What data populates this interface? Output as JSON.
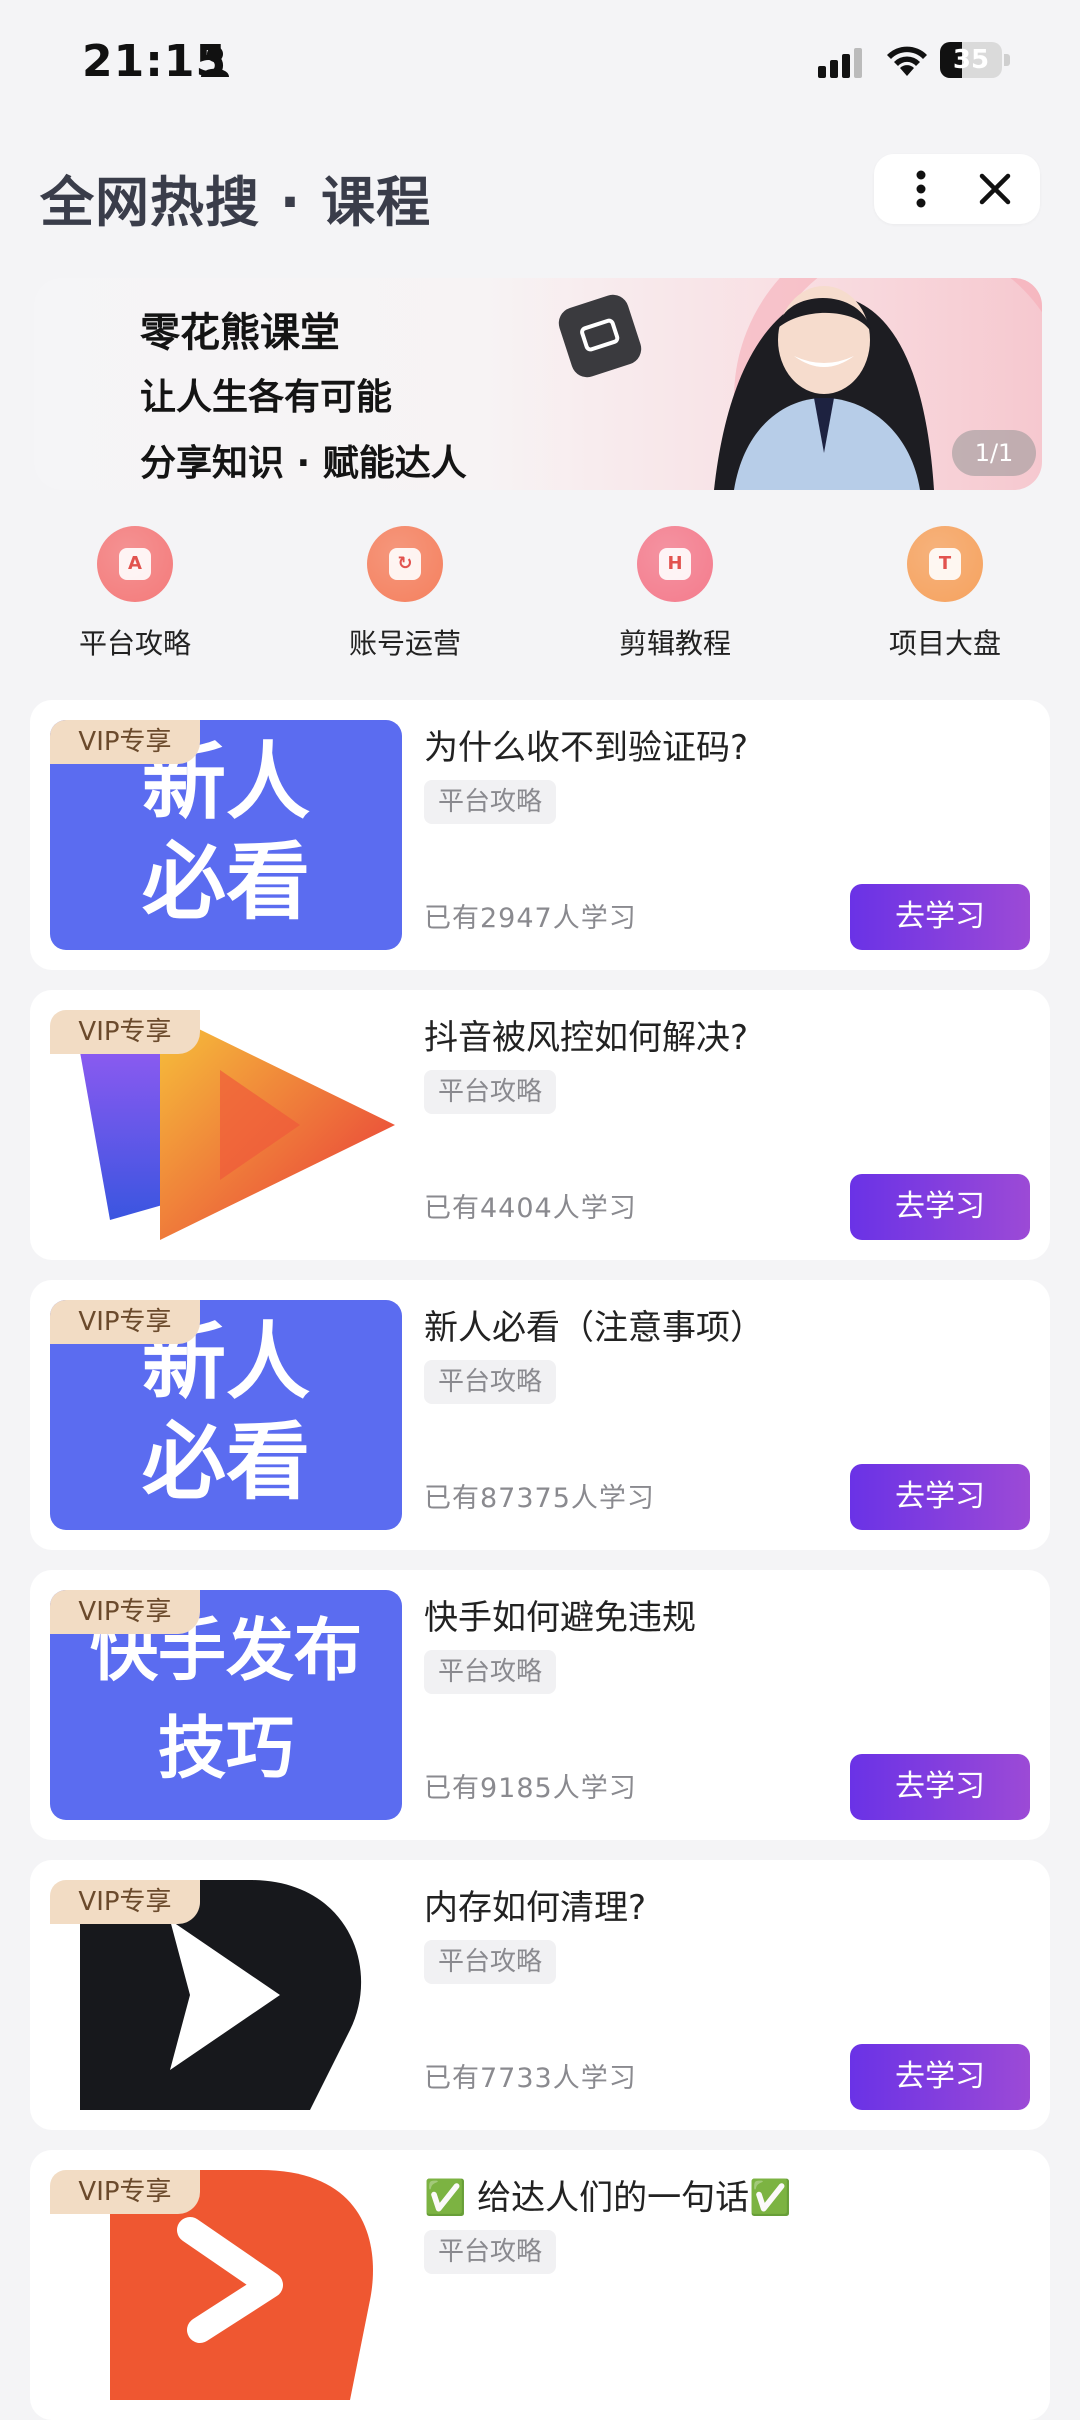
{
  "status_bar": {
    "time": "21:15",
    "battery": "35",
    "battery_level": 0.35
  },
  "header": {
    "title": "全网热搜 · 课程"
  },
  "banner": {
    "line1": "零花熊课堂",
    "line2": "让人生各有可能",
    "line3": "分享知识 · 赋能达人",
    "page_indicator": "1/1"
  },
  "categories": [
    {
      "label": "平台攻略",
      "icon": "A",
      "color": "#f47a7a"
    },
    {
      "label": "账号运营",
      "icon": "↻",
      "color": "#f5805e"
    },
    {
      "label": "剪辑教程",
      "icon": "H",
      "color": "#f47b8c"
    },
    {
      "label": "项目大盘",
      "icon": "T",
      "color": "#f6a25e"
    }
  ],
  "colors": {
    "accent_start": "#6a32e6",
    "accent_end": "#9c4ad6",
    "vip_badge": "#f2dcc4",
    "thumb_blue": "#5b6cf0"
  },
  "courses": [
    {
      "badge": "VIP专享",
      "title": "为什么收不到验证码?",
      "tag": "平台攻略",
      "stats": "已有2947人学习",
      "button": "去学习",
      "thumb_line1": "新人",
      "thumb_line2": "必看"
    },
    {
      "badge": "VIP专享",
      "title": "抖音被风控如何解决?",
      "tag": "平台攻略",
      "stats": "已有4404人学习",
      "button": "去学习"
    },
    {
      "badge": "VIP专享",
      "title": "新人必看（注意事项）",
      "tag": "平台攻略",
      "stats": "已有87375人学习",
      "button": "去学习",
      "thumb_line1": "新人",
      "thumb_line2": "必看"
    },
    {
      "badge": "VIP专享",
      "title": "快手如何避免违规",
      "tag": "平台攻略",
      "stats": "已有9185人学习",
      "button": "去学习",
      "thumb_line1": "快手发布",
      "thumb_line2": "技巧"
    },
    {
      "badge": "VIP专享",
      "title": "内存如何清理?",
      "tag": "平台攻略",
      "stats": "已有7733人学习",
      "button": "去学习"
    },
    {
      "badge": "VIP专享",
      "title": "✅ 给达人们的一句话✅",
      "tag": "平台攻略"
    }
  ]
}
